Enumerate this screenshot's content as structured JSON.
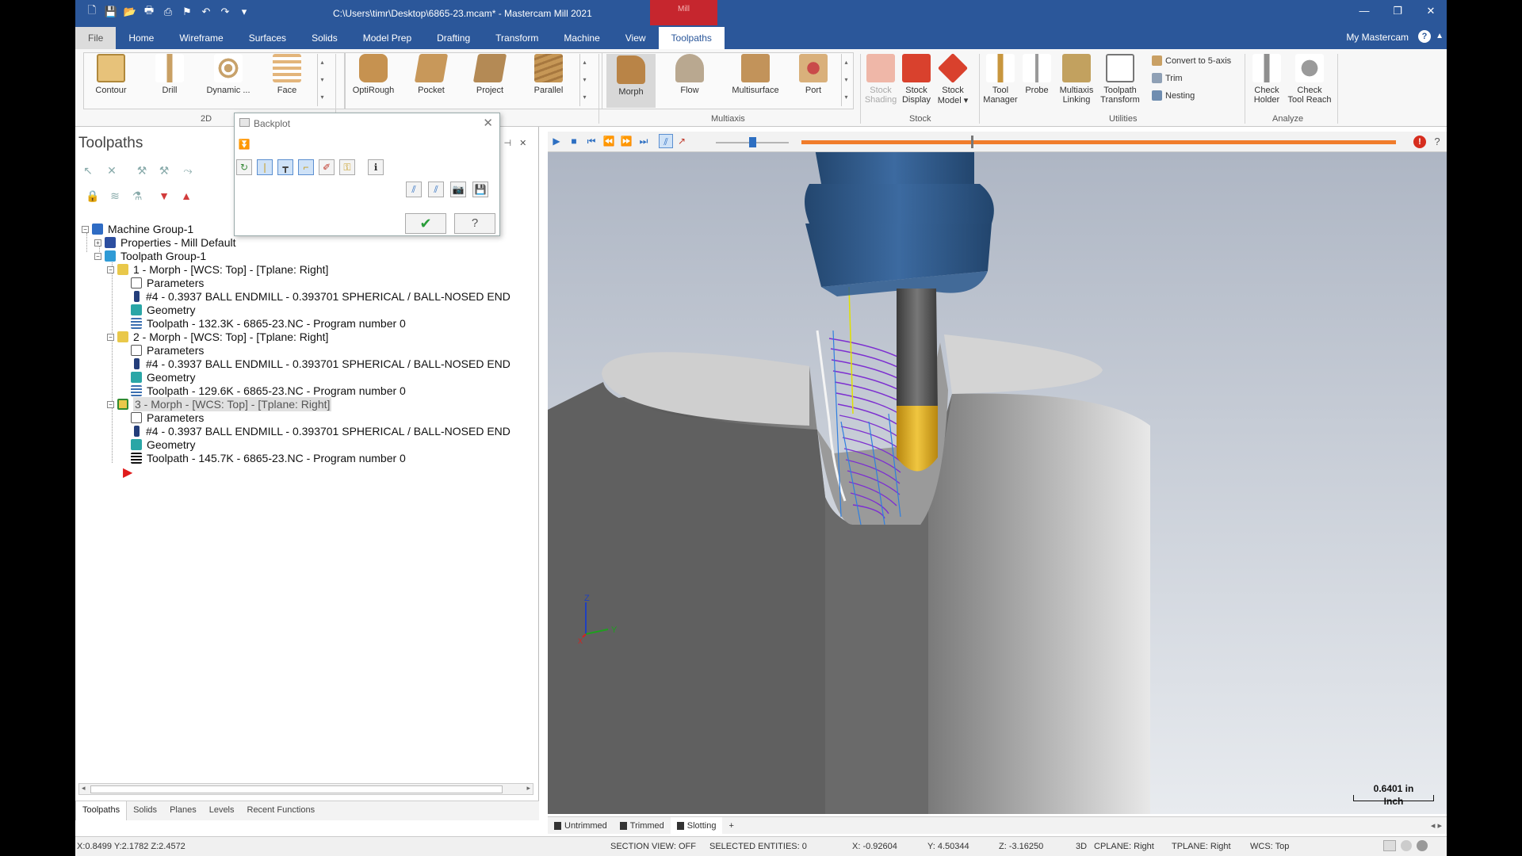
{
  "window": {
    "title": "C:\\Users\\timr\\Desktop\\6865-23.mcam* - Mastercam Mill 2021",
    "context_tab": "Mill",
    "controls": [
      "minimize",
      "restore",
      "close"
    ]
  },
  "tabs": [
    "File",
    "Home",
    "Wireframe",
    "Surfaces",
    "Solids",
    "Model Prep",
    "Drafting",
    "Transform",
    "Machine",
    "View",
    "Toolpaths"
  ],
  "active_tab": "Toolpaths",
  "account": {
    "label": "My Mastercam"
  },
  "ribbon": {
    "g2d": {
      "label": "2D",
      "buttons": [
        "Contour",
        "Drill",
        "Dynamic ...",
        "Face"
      ],
      "buttons2": [
        "OptiRough",
        "Pocket",
        "Project",
        "Parallel"
      ]
    },
    "multiaxis": {
      "label": "Multiaxis",
      "buttons": [
        "Morph",
        "Flow",
        "Multisurface",
        "Port"
      ]
    },
    "stock": {
      "label": "Stock",
      "buttons": [
        {
          "l1": "Stock",
          "l2": "Shading"
        },
        {
          "l1": "Stock",
          "l2": "Display"
        },
        {
          "l1": "Stock",
          "l2": "Model ▾"
        }
      ]
    },
    "utilities": {
      "label": "Utilities",
      "buttons": [
        {
          "l1": "Tool",
          "l2": "Manager"
        },
        {
          "l1": "Probe",
          "l2": ""
        },
        {
          "l1": "Multiaxis",
          "l2": "Linking"
        },
        {
          "l1": "Toolpath",
          "l2": "Transform"
        }
      ],
      "small": [
        "Convert to 5-axis",
        "Trim",
        "Nesting"
      ]
    },
    "analyze": {
      "label": "Analyze",
      "buttons": [
        {
          "l1": "Check",
          "l2": "Holder"
        },
        {
          "l1": "Check",
          "l2": "Tool Reach"
        }
      ]
    }
  },
  "panel": {
    "title": "Toolpaths",
    "tabs": [
      "Toolpaths",
      "Solids",
      "Planes",
      "Levels",
      "Recent Functions"
    ],
    "active_tab": "Toolpaths"
  },
  "tree": {
    "machine_group": "Machine Group-1",
    "properties": "Properties - Mill Default",
    "toolpath_group": "Toolpath Group-1",
    "operations": [
      {
        "name": "1 - Morph - [WCS: Top] - [Tplane: Right]",
        "parameters": "Parameters",
        "tool": "#4 - 0.3937 BALL ENDMILL - 0.393701 SPHERICAL / BALL-NOSED END",
        "geometry": "Geometry",
        "toolpath": "Toolpath - 132.3K - 6865-23.NC - Program number 0",
        "selected": false
      },
      {
        "name": "2 - Morph - [WCS: Top] - [Tplane: Right]",
        "parameters": "Parameters",
        "tool": "#4 - 0.3937 BALL ENDMILL - 0.393701 SPHERICAL / BALL-NOSED END",
        "geometry": "Geometry",
        "toolpath": "Toolpath - 129.6K - 6865-23.NC - Program number 0",
        "selected": false
      },
      {
        "name": "3 - Morph - [WCS: Top] - [Tplane: Right]",
        "parameters": "Parameters",
        "tool": "#4 - 0.3937 BALL ENDMILL - 0.393701 SPHERICAL / BALL-NOSED END",
        "geometry": "Geometry",
        "toolpath": "Toolpath - 145.7K - 6865-23.NC - Program number 0",
        "selected": true
      }
    ]
  },
  "backplot": {
    "title": "Backplot"
  },
  "viewport": {
    "scale_value": "0.6401 in",
    "scale_unit": "Inch",
    "axis_z": "Z",
    "axis_y": "Y",
    "axis_x": "X"
  },
  "viewsheets": [
    "Untrimmed",
    "Trimmed",
    "Slotting"
  ],
  "viewsheet_add": "+",
  "status": {
    "xyz": "X:0.8499   Y:2.1782   Z:2.4572",
    "section_view": "SECTION VIEW: OFF",
    "selected_entities": "SELECTED ENTITIES: 0",
    "x": "X:   -0.92604",
    "y": "Y:   4.50344",
    "z": "Z:   -3.16250",
    "mode": "3D",
    "cplane": "CPLANE: Right",
    "tplane": "TPLANE: Right",
    "wcs": "WCS: Top"
  },
  "colors": {
    "accent": "#2b579a",
    "context_tab": "#c6262e",
    "progress": "#f07c2b",
    "toolpath": "#7d2fd0",
    "tool_tip": "#e7b51c",
    "holder": "#2d5a8e"
  }
}
